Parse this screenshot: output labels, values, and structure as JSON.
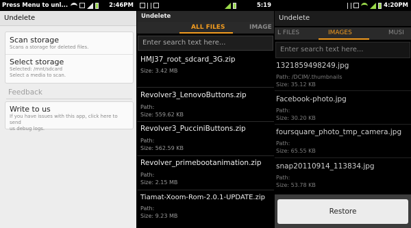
{
  "screen1": {
    "status": {
      "notification": "Press Menu to unl...",
      "time": "2:46PM"
    },
    "title": "Undelete",
    "scan": {
      "title": "Scan storage",
      "subtitle": "Scans a storage for deleted files."
    },
    "select": {
      "title": "Select storage",
      "line1": "Selected: /mnt/sdcard",
      "line2": "Select a media to scan."
    },
    "feedback_header": "Feedback",
    "write": {
      "title": "Write to us",
      "line1": "If you have issues with this app, click here to send",
      "line2": "us debug logs."
    }
  },
  "screen2": {
    "status": {
      "time": "5:19"
    },
    "title": "Undelete",
    "tabs": {
      "all_files": "ALL FILES",
      "images": "IMAGE"
    },
    "search_placeholder": "Enter search text here...",
    "files": [
      {
        "name": "HMJ37_root_sdcard_3G.zip",
        "size": "Size: 3.42 MB"
      },
      {
        "name": "Revolver3_LenovoButtons.zip",
        "path": "Path:",
        "size": "Size: 559.62 KB"
      },
      {
        "name": "Revolver3_PucciniButtons.zip",
        "path": "Path:",
        "size": "Size: 562.59 KB"
      },
      {
        "name": "Revolver_primebootanimation.zip",
        "path": "Path:",
        "size": "Size: 2.15 MB"
      },
      {
        "name": "Tiamat-Xoom-Rom-2.0.1-UPDATE.zip",
        "path": "Path:",
        "size": "Size: 9.23 MB"
      }
    ]
  },
  "screen3": {
    "status": {
      "time": "4:20PM"
    },
    "title": "Undelete",
    "tabs": {
      "all_files": "L FILES",
      "images": "IMAGES",
      "music": "MUSI"
    },
    "search_placeholder": "Enter search text here...",
    "files": [
      {
        "name": "1321859498249.jpg",
        "path": "Path: /DCIM/.thumbnails",
        "size": "Size: 35.12 KB"
      },
      {
        "name": "Facebook-photo.jpg",
        "path": "Path:",
        "size": "Size: 30.20 KB"
      },
      {
        "name": "foursquare_photo_tmp_camera.jpg",
        "path": "Path:",
        "size": "Size: 65.55 KB"
      },
      {
        "name": "snap20110914_113834.jpg",
        "path": "Path:",
        "size": "Size: 53.78 KB"
      }
    ],
    "restore_label": "Restore"
  },
  "colors": {
    "accent": "#f39c1f",
    "light_bg": "#ededed",
    "dark_bg": "#000000"
  }
}
